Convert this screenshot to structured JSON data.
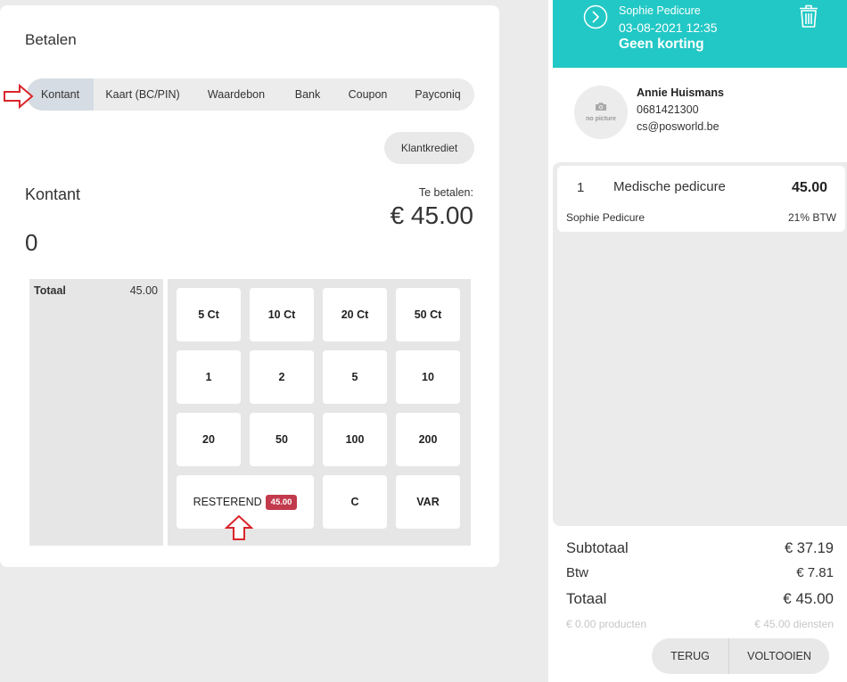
{
  "payment": {
    "title": "Betalen",
    "methods": [
      {
        "label": "Kontant",
        "selected": true
      },
      {
        "label": "Kaart (BC/PIN)",
        "selected": false
      },
      {
        "label": "Waardebon",
        "selected": false
      },
      {
        "label": "Bank",
        "selected": false
      },
      {
        "label": "Coupon",
        "selected": false
      },
      {
        "label": "Payconiq",
        "selected": false
      }
    ],
    "customer_credit_label": "Klantkrediet",
    "method_title": "Kontant",
    "due_label": "Te betalen:",
    "due_amount": "€ 45.00",
    "entered_amount": "0",
    "tenders": {
      "total_label": "Totaal",
      "total_value": "45.00"
    },
    "keypad": {
      "rows": [
        [
          "5 Ct",
          "10 Ct",
          "20 Ct",
          "50 Ct"
        ],
        [
          "1",
          "2",
          "5",
          "10"
        ],
        [
          "20",
          "50",
          "100",
          "200"
        ]
      ],
      "remaining_label": "RESTEREND",
      "remaining_badge": "45.00",
      "clear_label": "C",
      "var_label": "VAR"
    }
  },
  "ticket": {
    "staff_name": "Sophie Pedicure",
    "datetime": "03-08-2021 12:35",
    "discount": "Geen korting",
    "customer": {
      "name": "Annie Huismans",
      "phone": "0681421300",
      "email": "cs@posworld.be",
      "avatar_placeholder": "no picture"
    },
    "items": [
      {
        "quantity": "1",
        "name": "Medische pedicure",
        "price": "45.00",
        "staff": "Sophie Pedicure",
        "vat": "21% BTW"
      }
    ],
    "totals": {
      "subtotal_label": "Subtotaal",
      "subtotal": "€ 37.19",
      "vat_label": "Btw",
      "vat": "€ 7.81",
      "total_label": "Totaal",
      "total": "€ 45.00",
      "products": "€ 0.00 producten",
      "services": "€ 45.00 diensten"
    },
    "actions": {
      "back_label": "TERUG",
      "complete_label": "VOLTOOIEN"
    }
  },
  "icons": {
    "open_ticket": "chevron-right-circle-icon",
    "delete_ticket": "trash-icon",
    "avatar": "camera-icon",
    "annotations": [
      "arrow-right-outline-icon",
      "arrow-up-outline-icon"
    ]
  },
  "colors": {
    "accent": "#22c8c5",
    "badge": "#c23a4c",
    "annotation": "#d9252b",
    "selected_tab": "#d6dce3"
  }
}
